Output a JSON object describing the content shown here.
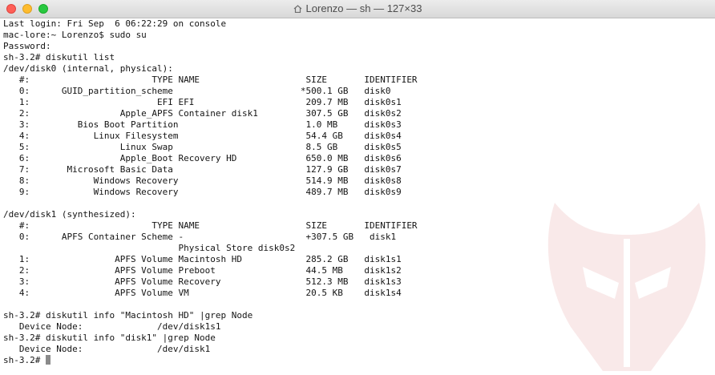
{
  "window": {
    "title": "Lorenzo — sh — 127×33",
    "home_icon": "house-icon",
    "close_color": "#fe5f57",
    "minimize_color": "#febc2e",
    "zoom_color": "#28c840"
  },
  "terminal": {
    "lines": [
      "Last login: Fri Sep  6 06:22:29 on console",
      "mac-lore:~ Lorenzo$ sudo su",
      "Password:",
      "sh-3.2# diskutil list",
      "/dev/disk0 (internal, physical):",
      "   #:                       TYPE NAME                    SIZE       IDENTIFIER",
      "   0:      GUID_partition_scheme                        *500.1 GB   disk0",
      "   1:                        EFI EFI                     209.7 MB   disk0s1",
      "   2:                 Apple_APFS Container disk1         307.5 GB   disk0s2",
      "   3:         Bios Boot Partition                        1.0 MB     disk0s3",
      "   4:            Linux Filesystem                        54.4 GB    disk0s4",
      "   5:                 Linux Swap                         8.5 GB     disk0s5",
      "   6:                 Apple_Boot Recovery HD             650.0 MB   disk0s6",
      "   7:       Microsoft Basic Data                         127.9 GB   disk0s7",
      "   8:            Windows Recovery                        514.9 MB   disk0s8",
      "   9:            Windows Recovery                        489.7 MB   disk0s9",
      "",
      "/dev/disk1 (synthesized):",
      "   #:                       TYPE NAME                    SIZE       IDENTIFIER",
      "   0:      APFS Container Scheme -                       +307.5 GB   disk1",
      "                                 Physical Store disk0s2",
      "   1:                APFS Volume Macintosh HD            285.2 GB   disk1s1",
      "   2:                APFS Volume Preboot                 44.5 MB    disk1s2",
      "   3:                APFS Volume Recovery                512.3 MB   disk1s3",
      "   4:                APFS Volume VM                      20.5 KB    disk1s4",
      "",
      "sh-3.2# diskutil info \"Macintosh HD\" |grep Node",
      "   Device Node:              /dev/disk1s1",
      "sh-3.2# diskutil info \"disk1\" |grep Node",
      "   Device Node:              /dev/disk1"
    ],
    "prompt": "sh-3.2# "
  },
  "watermark": {
    "icon": "helmet-logo-icon",
    "color": "#c01818"
  }
}
